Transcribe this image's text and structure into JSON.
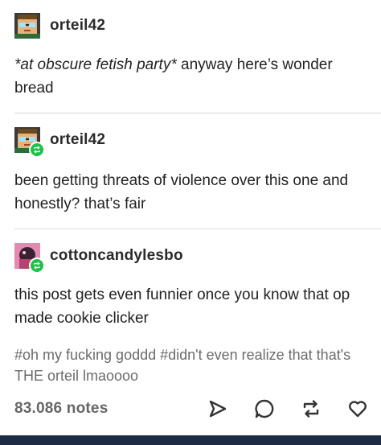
{
  "posts": [
    {
      "username": "orteil42",
      "avatar_icon": "pixel-face-avatar-icon",
      "body_italic": "*at obscure fetish party*",
      "body_rest": " anyway here’s wonder bread"
    },
    {
      "username": "orteil42",
      "avatar_icon": "pixel-face-avatar-icon",
      "reblog_icon": "reblog-badge-icon",
      "body": "been getting threats of violence over this one and honestly? that’s fair"
    },
    {
      "username": "cottoncandylesbo",
      "avatar_icon": "pink-avatar-icon",
      "reblog_icon": "reblog-badge-icon",
      "body": "this post gets even funnier once you know that op made cookie clicker"
    }
  ],
  "tags": "#oh my fucking goddd  #didn't even realize that that's THE orteil lmaoooo",
  "footer": {
    "notes": "83.086 notes",
    "actions": [
      "share-icon",
      "reply-icon",
      "reblog-icon",
      "like-icon"
    ]
  },
  "colors": {
    "reblog_green": "#1ec04a",
    "bottom_bar": "#1b2c44",
    "tag_gray": "#6b6b6b"
  }
}
